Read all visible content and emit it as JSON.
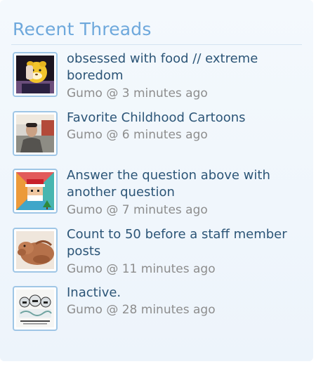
{
  "widget": {
    "title": "Recent Threads"
  },
  "threads": [
    {
      "title": "obsessed with food // extreme boredom",
      "author": "Gumo",
      "separator": "@",
      "time": "3 minutes ago"
    },
    {
      "title": "Favorite Childhood Cartoons",
      "author": "Gumo",
      "separator": "@",
      "time": "6 minutes ago"
    },
    {
      "title": "Answer the question above with another question",
      "author": "Gumo",
      "separator": "@",
      "time": "7 minutes ago"
    },
    {
      "title": "Count to 50 before a staff member posts",
      "author": "Gumo",
      "separator": "@",
      "time": "11 minutes ago"
    },
    {
      "title": "Inactive.",
      "author": "Gumo",
      "separator": "@",
      "time": "28 minutes ago"
    }
  ]
}
